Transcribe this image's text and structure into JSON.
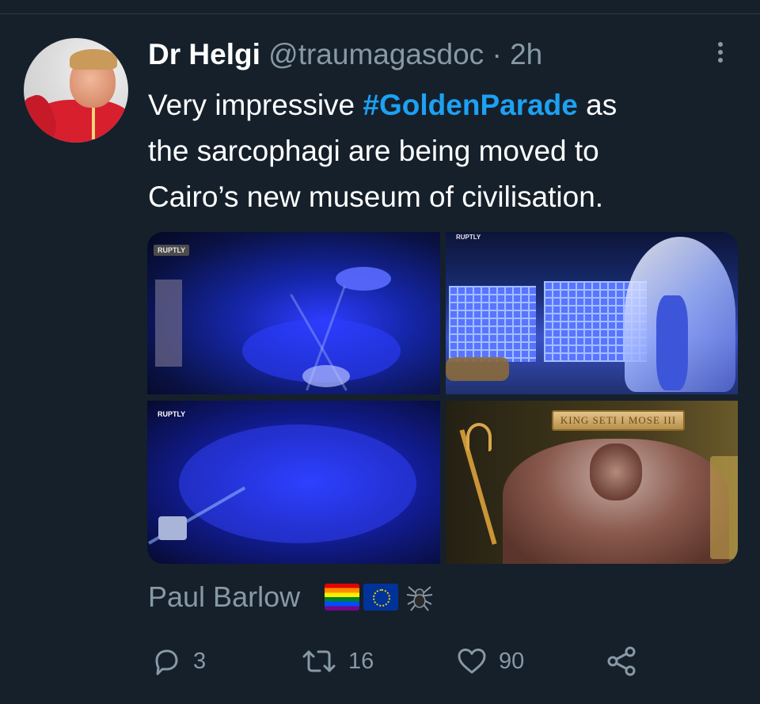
{
  "tweet": {
    "author_name": "Dr Helgi",
    "author_handle": "@traumagasdoc",
    "separator": "·",
    "time": "2h",
    "text_line1_before": "Very impressive ",
    "hashtag": "#GoldenParade",
    "text_line1_after": " as",
    "text_line2": "the sarcophagi are being moved to",
    "text_line3": "Cairo’s new museum of civilisation.",
    "media": {
      "badge_1": "RUPTLY",
      "badge_2": "RUPTLY",
      "badge_3": "RUPTLY",
      "plaque": "KING SETI I MOSE III"
    },
    "reposter_name": "Paul Barlow",
    "reposter_flags": [
      "rainbow-flag-icon",
      "eu-flag-icon",
      "spider-icon"
    ],
    "stats": {
      "replies": "3",
      "retweets": "16",
      "likes": "90"
    }
  },
  "colors": {
    "background": "#15202b",
    "hashtag": "#1da1f2",
    "secondary_text": "#8899a6"
  }
}
